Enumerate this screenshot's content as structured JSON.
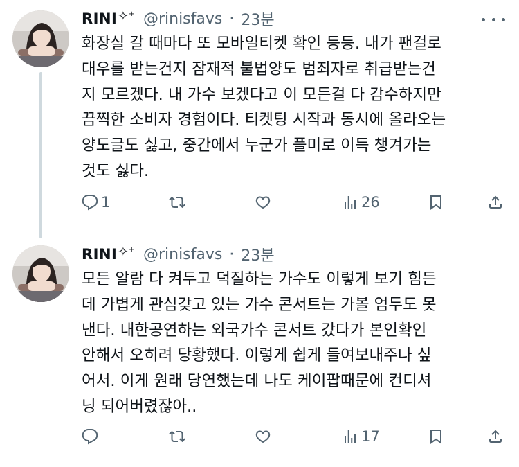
{
  "tweets": [
    {
      "author": {
        "display_name": "RINI",
        "name_decoration": "✧⁺",
        "handle": "@rinisfavs",
        "avatar_icon": "profile-photo"
      },
      "separator": "·",
      "time": "23분",
      "text_lines": [
        "화장실 갈 때마다 또 모바일티켓 확인 등등. 내가 팬걸로",
        "대우를 받는건지 잠재적 불법양도 범죄자로 취급받는건",
        "지 모르겠다. 내 가수 보겠다고 이 모든걸 다 감수하지만",
        "끔찍한 소비자 경험이다. 티켓팅 시작과 동시에 올라오는",
        "양도글도 싫고, 중간에서 누군가 플미로 이득 챙겨가는",
        "것도 싫다."
      ],
      "actions": {
        "reply_count": "1",
        "retweet_count": "",
        "like_count": "",
        "view_count": "26"
      }
    },
    {
      "author": {
        "display_name": "RINI",
        "name_decoration": "✧⁺",
        "handle": "@rinisfavs",
        "avatar_icon": "profile-photo"
      },
      "separator": "·",
      "time": "23분",
      "text_lines": [
        "모든 알람 다 켜두고 덕질하는 가수도 이렇게 보기 힘든",
        "데 가볍게 관심갖고 있는 가수 콘서트는 가볼 엄두도 못",
        "낸다. 내한공연하는 외국가수 콘서트 갔다가 본인확인",
        "안해서 오히려 당황했다. 이렇게 쉽게 들여보내주나 싶",
        "어서. 이게 원래 당연했는데 나도 케이팝때문에 컨디셔",
        "닝 되어버렸잖아.."
      ],
      "actions": {
        "reply_count": "",
        "retweet_count": "",
        "like_count": "",
        "view_count": "17"
      }
    }
  ],
  "icons": {
    "reply": "reply-icon",
    "retweet": "retweet-icon",
    "like": "heart-icon",
    "views": "views-icon",
    "bookmark": "bookmark-icon",
    "share": "share-icon",
    "more": "more-icon"
  },
  "colors": {
    "text_primary": "#0f1419",
    "text_secondary": "#536471",
    "thread_line": "#cfd9de",
    "background": "#ffffff"
  }
}
